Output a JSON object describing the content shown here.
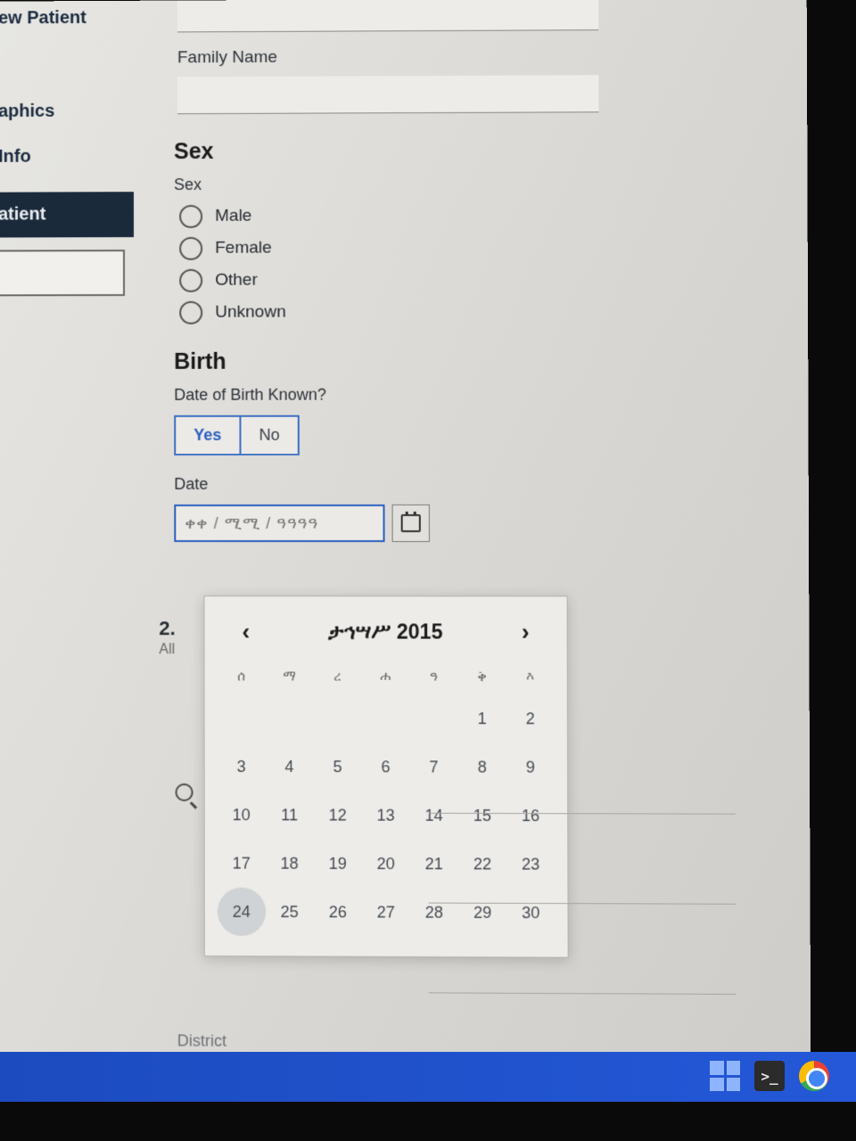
{
  "sidebar": {
    "items": [
      "ew Patient",
      "aphics",
      "Info",
      "atient"
    ]
  },
  "form": {
    "family_name_label": "Family Name",
    "sex_heading": "Sex",
    "sex_label": "Sex",
    "sex_options": [
      "Male",
      "Female",
      "Other",
      "Unknown"
    ],
    "birth_heading": "Birth",
    "dob_known_label": "Date of Birth Known?",
    "yes_label": "Yes",
    "no_label": "No",
    "date_label": "Date",
    "date_placeholder": "ቀቀ / ሚሚ / ዓዓዓዓ"
  },
  "partial": {
    "step_num": "2.",
    "all": "All",
    "district": "District"
  },
  "datepicker": {
    "title": "ታኅሣሥ 2015",
    "dow": [
      "ሰ",
      "ማ",
      "ረ",
      "ሐ",
      "ዓ",
      "ቅ",
      "እ"
    ],
    "weeks": [
      [
        "",
        "",
        "",
        "",
        "",
        "1",
        "2"
      ],
      [
        "3",
        "4",
        "5",
        "6",
        "7",
        "8",
        "9"
      ],
      [
        "10",
        "11",
        "12",
        "13",
        "14",
        "15",
        "16"
      ],
      [
        "17",
        "18",
        "19",
        "20",
        "21",
        "22",
        "23"
      ],
      [
        "24",
        "25",
        "26",
        "27",
        "28",
        "29",
        "30"
      ]
    ],
    "today": "24"
  }
}
